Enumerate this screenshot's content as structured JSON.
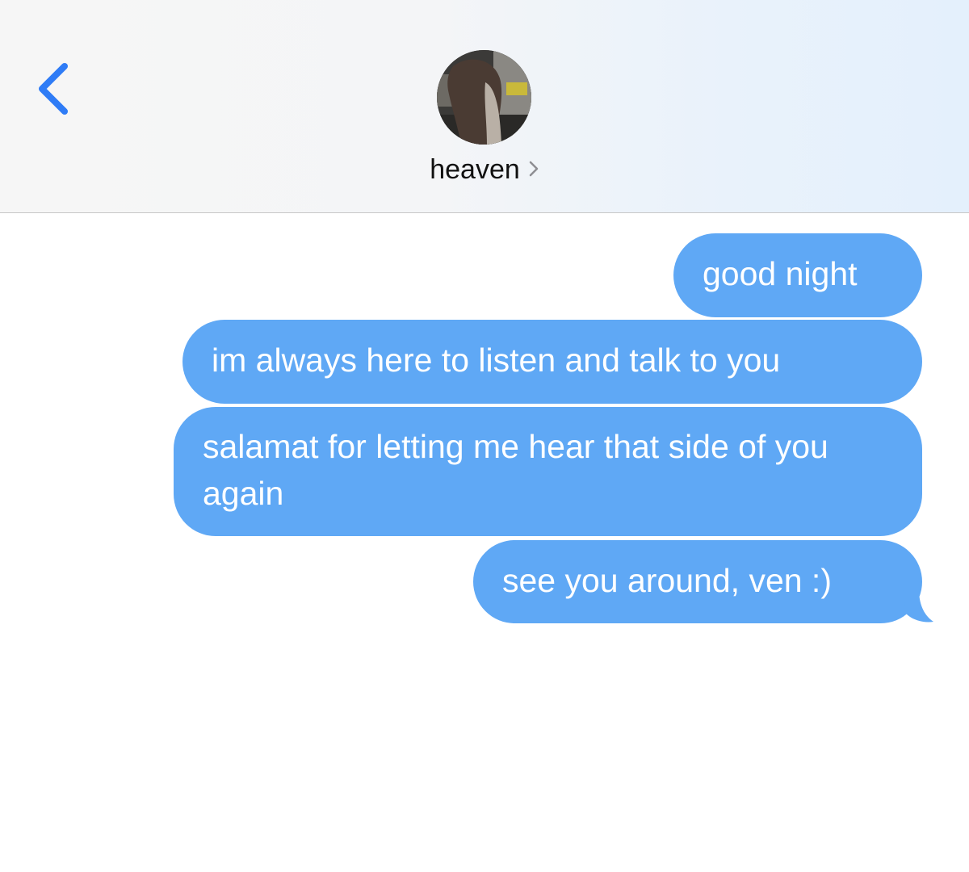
{
  "header": {
    "contact_name": "heaven",
    "back_icon": "chevron-left-icon",
    "disclosure_icon": "chevron-right-icon"
  },
  "messages": [
    {
      "text": "good night",
      "direction": "outgoing"
    },
    {
      "text": "im always here to listen and talk to you",
      "direction": "outgoing"
    },
    {
      "text": "salamat for letting me hear that side of you again",
      "direction": "outgoing"
    },
    {
      "text": "see you around, ven :)",
      "direction": "outgoing"
    }
  ],
  "colors": {
    "accent": "#2f7cf6",
    "bubble": "#5fa8f5",
    "bubble_text": "#ffffff",
    "header_bg": "#f6f6f6"
  }
}
